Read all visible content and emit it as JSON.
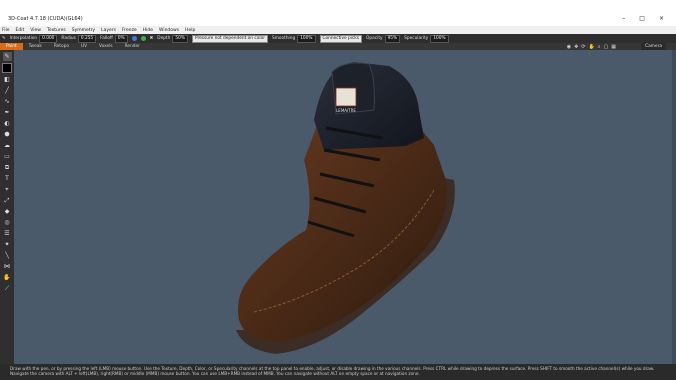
{
  "window": {
    "title": "3D-Coat 4.7.18 (CUDA)(GL64)",
    "minimize": "–",
    "maximize": "□",
    "close": "×"
  },
  "menu": [
    "File",
    "Edit",
    "View",
    "Textures",
    "Symmetry",
    "Layers",
    "Freeze",
    "Hide",
    "Windows",
    "Help"
  ],
  "toolbar": {
    "interpolation_label": "Interpolation",
    "interpolation_value": "0.000",
    "radius_label": "Radius",
    "radius_value": "0.255",
    "falloff_label": "Falloff",
    "falloff_value": "0%",
    "depth_label": "Depth",
    "depth_value": "50%",
    "smoothing_label": "Smoothing",
    "smoothing_value": "100%",
    "opacity_label": "Opacity",
    "opacity_value": "95%",
    "specularity_label": "Specularity",
    "specularity_value": "100%",
    "pressure_select": "Pressure not dependent on color",
    "pick_select": "Connective picks",
    "color_green": "#3cb043",
    "color_blue": "#3a7bd5"
  },
  "tabs": [
    "Paint",
    "Tweak",
    "Retopo",
    "UV",
    "Voxels",
    "Render"
  ],
  "active_tab": "Paint",
  "camera_label": "Camera",
  "view_icons": [
    "camera-icon",
    "move-icon",
    "rotate-icon",
    "pan-icon",
    "zoom-icon",
    "frame-icon",
    "grid-icon"
  ],
  "tools": [
    "brush-icon",
    "color-swatch",
    "fill-icon",
    "line-icon",
    "curve-icon",
    "pen-icon",
    "text-icon",
    "mask-icon",
    "stamp-icon",
    "smudge-icon",
    "eraser-icon",
    "clone-icon",
    "text-tool-icon",
    "picker-icon",
    "transform-icon",
    "bucket-icon",
    "eye-icon",
    "layers-icon",
    "sticker-icon",
    "ruler-icon",
    "paint-tool-icon",
    "butterfly-icon",
    "hand-icon",
    "knife-icon"
  ],
  "status": "Draw with the pen, or by pressing the left (LMB) mouse button. Use the Texture, Depth, Color, or Specularity channels at the top panel to enable, adjust, or disable drawing in the various channels. Press CTRL while drawing to depress the surface. Press SHIFT to smooth the active channel(s) while you draw. Navigate the camera with ALT + left(LMB), right(RMB) or middle (MMB) mouse button. You can use LMB+RMB instead of MMB. You can navigate without ALT on empty space or at navigation zone.",
  "model": {
    "logo_text": "LEMAITRE",
    "leather_color": "#4a2a17",
    "sole_color": "#3b2d25",
    "collar_color": "#1b1f28"
  }
}
